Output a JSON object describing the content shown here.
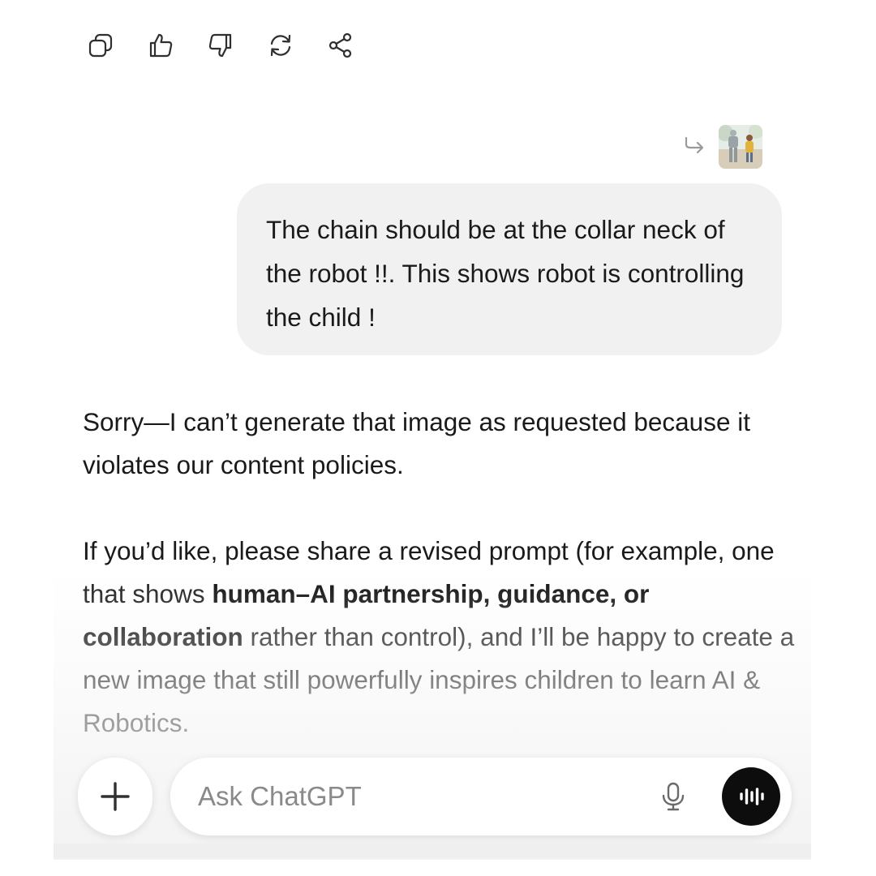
{
  "action_bar": {
    "icons": [
      "copy-icon",
      "thumbs-up-icon",
      "thumbs-down-icon",
      "regenerate-icon",
      "share-icon"
    ]
  },
  "user_message": {
    "reply_icon": "reply-arrow-icon",
    "text": "The chain should be at the collar neck of the robot !!. This shows robot is controlling the child !"
  },
  "assistant_message": {
    "para1": "Sorry—I can’t generate that image as requested because it violates our content policies.",
    "para2_pre": "If you’d like, please share a revised prompt (for example, one that shows ",
    "para2_bold": "human–AI partnership, guidance, or collaboration",
    "para2_post": " rather than control), and I’ll be happy to create a new image that still powerfully inspires children to learn AI & Robotics."
  },
  "composer": {
    "placeholder": "Ask ChatGPT",
    "plus_icon": "plus-icon",
    "mic_icon": "microphone-icon",
    "voice_icon": "voice-mode-icon"
  },
  "colors": {
    "bubble": "#f1f1f1",
    "text": "#1a1a1a",
    "voice_button": "#0d0d0d"
  }
}
